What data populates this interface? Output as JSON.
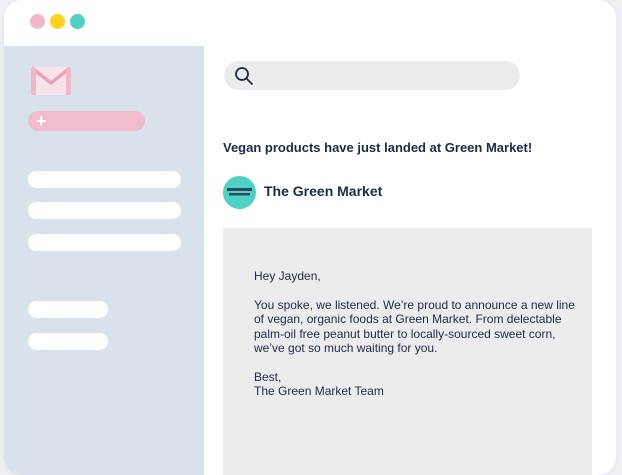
{
  "window": {
    "controls": {
      "close_color": "#f2b6c9",
      "minimize_color": "#ffd21e",
      "maximize_color": "#4fd1c5"
    }
  },
  "sidebar": {
    "background": "#d9e2ea",
    "logo_icon": "gmail-m-icon",
    "compose": {
      "icon": "plus-icon",
      "label": "+",
      "color": "#f0bccc"
    },
    "nav_items": 5
  },
  "search": {
    "icon": "search-icon",
    "value": ""
  },
  "email": {
    "subject": "Vegan products have just landed at Green Market!",
    "sender": {
      "name": "The Green Market",
      "avatar_color": "#4fd1c5"
    },
    "body": {
      "greeting": "Hey Jayden,",
      "paragraph": "You spoke, we listened. We’re proud to announce a new line of vegan, organic foods at Green Market. From delectable palm-oil free peanut butter to locally-sourced sweet corn, we’ve got so much waiting for you.",
      "signoff": "Best,",
      "signature": "The Green Market Team"
    }
  }
}
